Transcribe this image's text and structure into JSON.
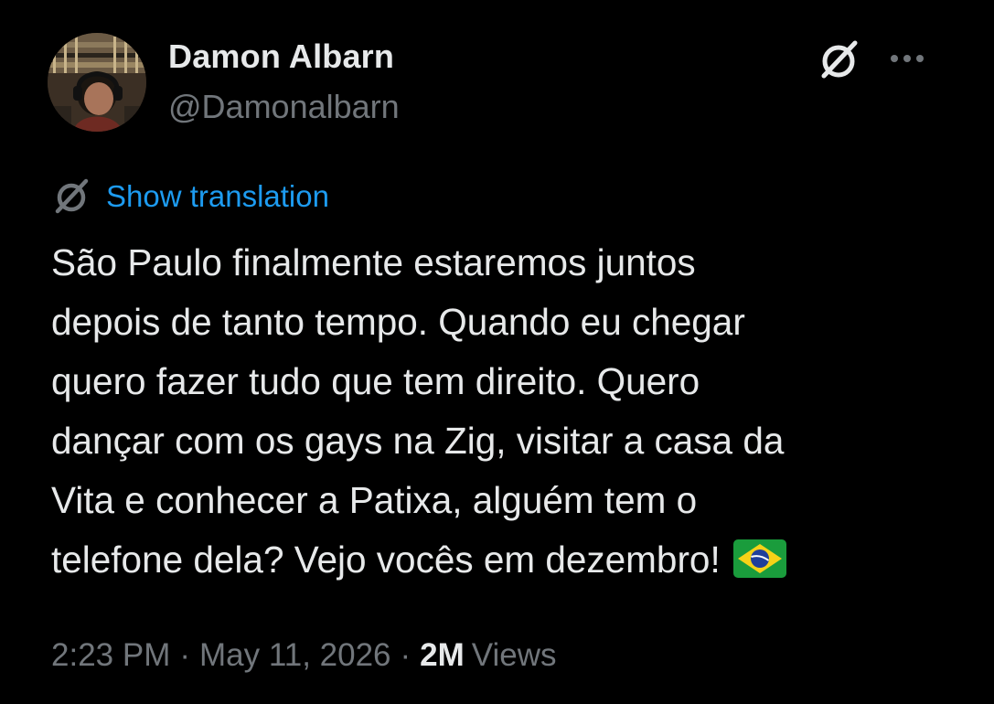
{
  "author": {
    "display_name": "Damon Albarn",
    "handle": "@Damonalbarn",
    "avatar_icon": "avatar-photo"
  },
  "header_icons": {
    "grok": "grok-slash-icon",
    "more": "more-dots-icon"
  },
  "translation": {
    "icon": "grok-slash-icon",
    "label": "Show translation"
  },
  "tweet": {
    "lines": [
      "São Paulo finalmente estaremos juntos",
      "depois de tanto tempo. Quando eu chegar",
      "quero fazer tudo que tem direito. Quero",
      "dançar com os gays na Zig, visitar a casa da",
      "Vita e conhecer a Patixa, alguém tem o",
      "telefone dela? Vejo vocês em dezembro!"
    ],
    "emoji": "brazil-flag-emoji"
  },
  "meta": {
    "time": "2:23 PM",
    "separator": "·",
    "date": "May 11, 2026",
    "views_count": "2M",
    "views_label": "Views"
  },
  "colors": {
    "background": "#000000",
    "text_primary": "#e7e9ea",
    "text_secondary": "#71767b",
    "link": "#1d9bf0"
  }
}
